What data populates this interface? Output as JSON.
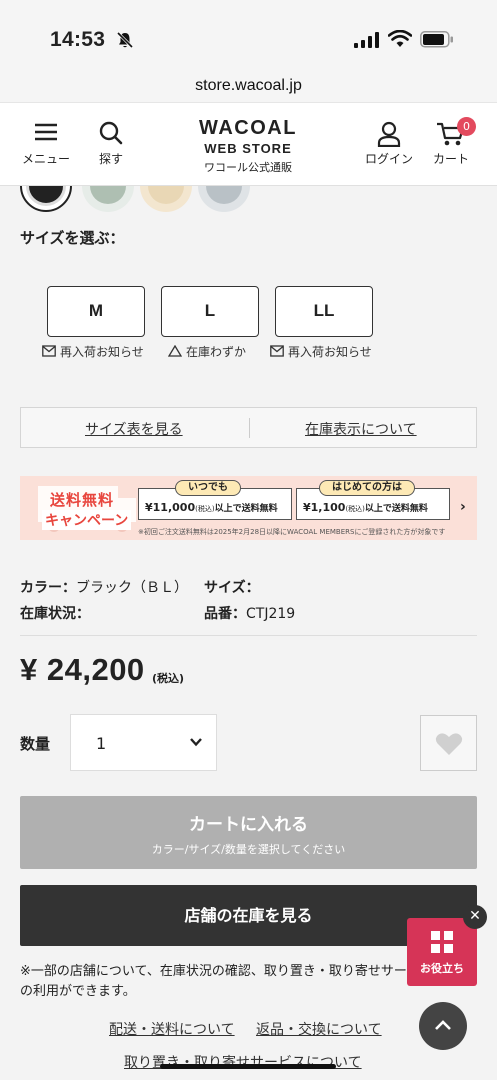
{
  "status_bar": {
    "time": "14:53"
  },
  "browser": {
    "url": "store.wacoal.jp"
  },
  "header": {
    "menu_label": "メニュー",
    "search_label": "探す",
    "logo_line1": "WACOAL",
    "logo_line2": "WEB STORE",
    "logo_line3": "ワコール公式通販",
    "login_label": "ログイン",
    "cart_label": "カート",
    "cart_count": "0"
  },
  "size_section": {
    "title": "サイズを選ぶ：",
    "options": [
      {
        "size": "M",
        "stock": "再入荷お知らせ",
        "stock_icon": "mail-icon"
      },
      {
        "size": "L",
        "stock": "在庫わずか",
        "stock_icon": "triangle-icon"
      },
      {
        "size": "LL",
        "stock": "再入荷お知らせ",
        "stock_icon": "mail-icon"
      }
    ]
  },
  "links": {
    "size_chart": "サイズ表を見る",
    "stock_info": "在庫表示について"
  },
  "banner": {
    "free_shipping": "送料無料",
    "campaign": "キャンペーン",
    "card1_tag": "いつでも",
    "card1_amount": "¥11,000",
    "card1_tax": "(税込)",
    "card1_suffix": "以上で送料無料",
    "card2_tag": "はじめての方は",
    "card2_amount": "¥1,100",
    "card2_tax": "(税込)",
    "card2_suffix": "以上で送料無料",
    "note": "※初回ご注文送料無料は2025年2月28日以降にWACOAL MEMBERSにご登録された方が対象です"
  },
  "specs": {
    "color_label": "カラー：",
    "color_value": "ブラック（ＢＬ）",
    "size_label": "サイズ：",
    "size_value": "",
    "stock_label": "在庫状況：",
    "stock_value": "",
    "item_no_label": "品番：",
    "item_no_value": "CTJ219"
  },
  "price": {
    "amount": "¥ 24,200",
    "tax": "(税込)"
  },
  "quantity": {
    "label": "数量",
    "value": "1"
  },
  "cart_button": {
    "label": "カートに入れる",
    "sub": "カラー/サイズ/数量を選択してください"
  },
  "store_button": {
    "label": "店舗の在庫を見る"
  },
  "note": "※一部の店舗について、在庫状況の確認、取り置き・取り寄せサービスの利用ができます。",
  "footer_links": {
    "shipping": "配送・送料について",
    "returns": "返品・交換について",
    "reserve": "取り置き・取り寄せサービスについて"
  },
  "help": {
    "label": "お役立ち"
  },
  "colors": {
    "accent": "#d63457",
    "cart_badge": "#e34a5e",
    "disabled_button": "#b0b0b0",
    "dark_button": "#333333"
  }
}
